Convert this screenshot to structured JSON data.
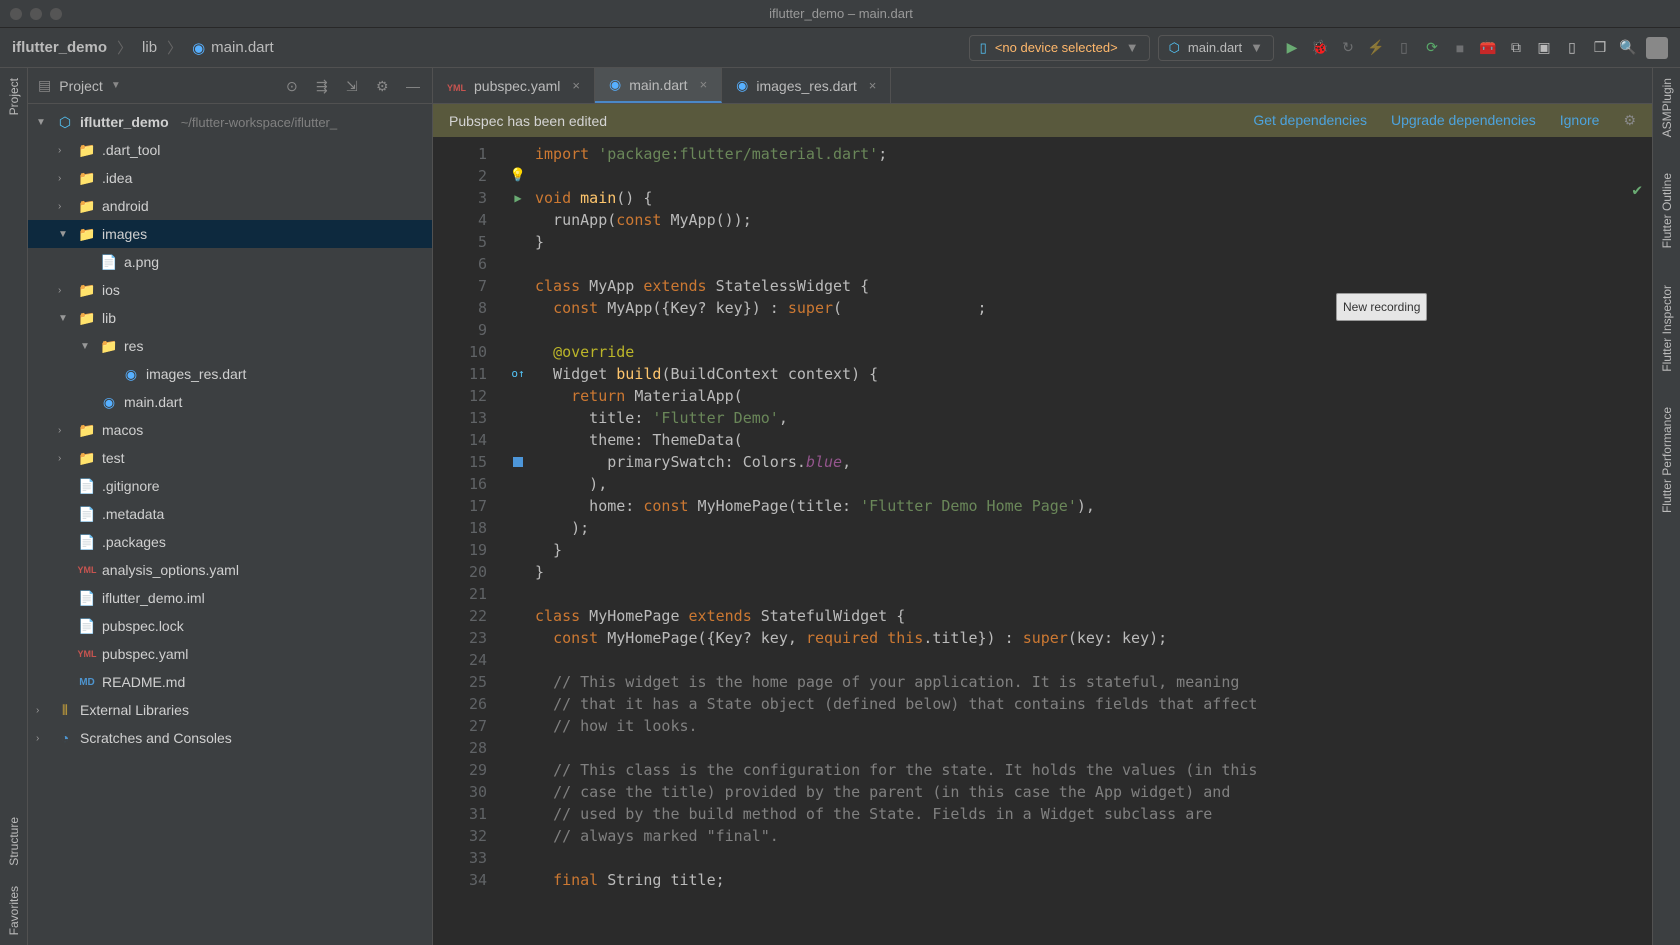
{
  "window": {
    "title": "iflutter_demo – main.dart"
  },
  "breadcrumb": {
    "project": "iflutter_demo",
    "folder": "lib",
    "file": "main.dart"
  },
  "device_selector": {
    "label": "<no device selected>"
  },
  "run_config": {
    "label": "main.dart"
  },
  "toolbar_icons": [
    "run",
    "debug",
    "coverage",
    "profile",
    "attach",
    "hotreload",
    "stop",
    "devtools",
    "toolbox",
    "layout",
    "inspector",
    "widgets",
    "pkg",
    "search",
    "avatar"
  ],
  "project_panel": {
    "title": "Project",
    "root": {
      "name": "iflutter_demo",
      "path": "~/flutter-workspace/iflutter_",
      "children": [
        {
          "name": ".dart_tool",
          "icon": "folder-orange",
          "expandable": true,
          "depth": 1
        },
        {
          "name": ".idea",
          "icon": "folder-gray",
          "expandable": true,
          "depth": 1
        },
        {
          "name": "android",
          "icon": "folder-gray",
          "expandable": true,
          "depth": 1
        },
        {
          "name": "images",
          "icon": "folder-blue",
          "expandable": true,
          "expanded": true,
          "selected": true,
          "depth": 1
        },
        {
          "name": "a.png",
          "icon": "file",
          "depth": 2
        },
        {
          "name": "ios",
          "icon": "folder-gray",
          "expandable": true,
          "depth": 1
        },
        {
          "name": "lib",
          "icon": "folder-blue",
          "expandable": true,
          "expanded": true,
          "depth": 1
        },
        {
          "name": "res",
          "icon": "folder-blue",
          "expandable": true,
          "expanded": true,
          "depth": 2
        },
        {
          "name": "images_res.dart",
          "icon": "dart",
          "depth": 3
        },
        {
          "name": "main.dart",
          "icon": "dart",
          "depth": 2
        },
        {
          "name": "macos",
          "icon": "folder-gray",
          "expandable": true,
          "depth": 1
        },
        {
          "name": "test",
          "icon": "folder-green",
          "expandable": true,
          "depth": 1
        },
        {
          "name": ".gitignore",
          "icon": "file",
          "depth": 1
        },
        {
          "name": ".metadata",
          "icon": "file",
          "depth": 1
        },
        {
          "name": ".packages",
          "icon": "file",
          "depth": 1
        },
        {
          "name": "analysis_options.yaml",
          "icon": "yaml",
          "depth": 1
        },
        {
          "name": "iflutter_demo.iml",
          "icon": "file",
          "depth": 1
        },
        {
          "name": "pubspec.lock",
          "icon": "file",
          "depth": 1
        },
        {
          "name": "pubspec.yaml",
          "icon": "yaml",
          "depth": 1
        },
        {
          "name": "README.md",
          "icon": "md",
          "depth": 1
        }
      ]
    },
    "extra": [
      {
        "name": "External Libraries",
        "icon": "libs"
      },
      {
        "name": "Scratches and Consoles",
        "icon": "scratches"
      }
    ]
  },
  "editor_tabs": [
    {
      "label": "pubspec.yaml",
      "icon": "yaml",
      "active": false
    },
    {
      "label": "main.dart",
      "icon": "dart",
      "active": true
    },
    {
      "label": "images_res.dart",
      "icon": "dart",
      "active": false
    }
  ],
  "notification": {
    "message": "Pubspec has been edited",
    "actions": {
      "get": "Get dependencies",
      "upgrade": "Upgrade dependencies",
      "ignore": "Ignore"
    }
  },
  "tooltip": {
    "text": "New recording"
  },
  "left_rail": [
    "Project",
    "Structure",
    "Favorites"
  ],
  "right_rail": [
    "ASMPlugin",
    "Flutter Outline",
    "Flutter Inspector",
    "Flutter Performance"
  ],
  "code": {
    "line_count": 34
  }
}
